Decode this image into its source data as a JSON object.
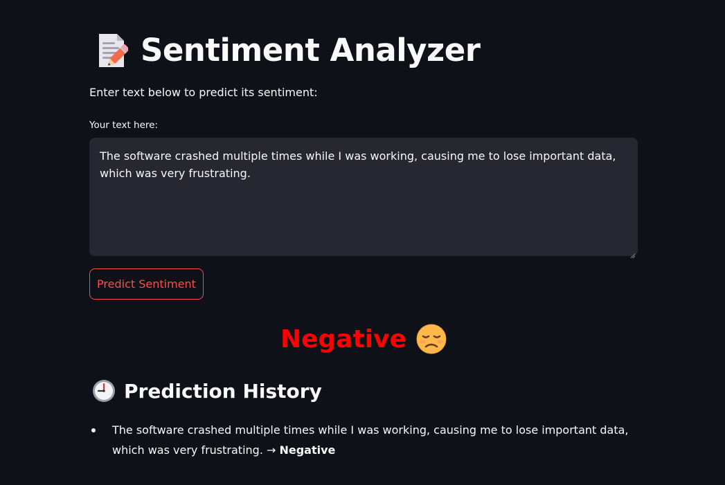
{
  "app": {
    "title": "Sentiment Analyzer",
    "title_icon": "memo-icon",
    "intro": "Enter text below to predict its sentiment:"
  },
  "input": {
    "label": "Your text here:",
    "value": "The software crashed multiple times while I was working, causing me to lose important data, which was very frustrating."
  },
  "predict_button": {
    "label": "Predict Sentiment"
  },
  "result": {
    "label": "Negative",
    "icon": "sad-face-icon",
    "color": "#ff0000"
  },
  "history": {
    "title": "Prediction History",
    "icon": "clock-icon",
    "items": [
      {
        "text": "The software crashed multiple times while I was working, causing me to lose important data, which was very frustrating. →",
        "label": "Negative"
      }
    ]
  },
  "colors": {
    "background": "#0e1117",
    "input_background": "#262730",
    "accent": "#ff4b4b",
    "text": "#fafafa"
  }
}
